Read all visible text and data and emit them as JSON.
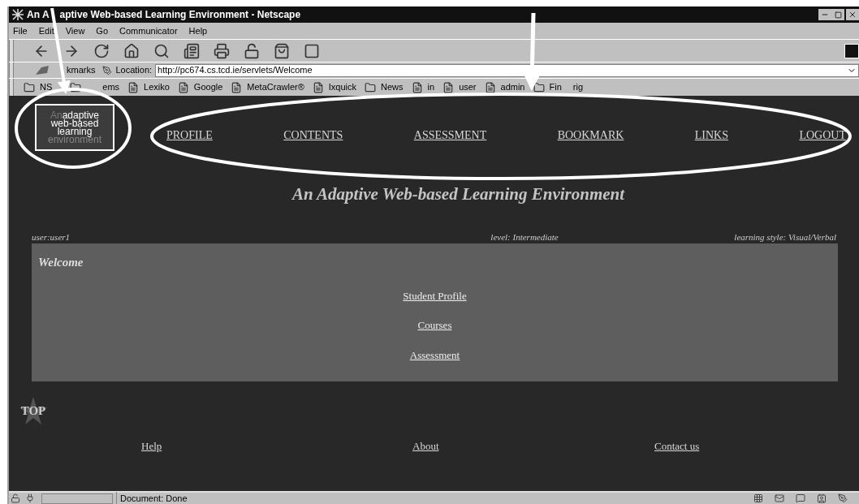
{
  "window": {
    "title_parts": [
      "An A",
      "aptive Web-based Learning Environment - Netscape"
    ]
  },
  "menu": [
    {
      "label": "File"
    },
    {
      "label": "Edit"
    },
    {
      "label": "View"
    },
    {
      "label": "Go"
    },
    {
      "label": "Communicator"
    },
    {
      "label": "Help"
    }
  ],
  "location_bar": {
    "bookmarks_label": "kmarks",
    "label": "Location:",
    "url": "http://pc674.cs.tcd.ie/servlets/Welcome"
  },
  "personal_toolbar": [
    {
      "kind": "folder",
      "parts": [
        "NS"
      ]
    },
    {
      "kind": "folder",
      "parts": [
        "ems"
      ]
    },
    {
      "kind": "page",
      "parts": [
        "Lexiko"
      ]
    },
    {
      "kind": "page",
      "parts": [
        "Google"
      ]
    },
    {
      "kind": "page",
      "parts": [
        "MetaCrawler®"
      ]
    },
    {
      "kind": "page",
      "parts": [
        "Ixquick"
      ]
    },
    {
      "kind": "folder",
      "parts": [
        "News"
      ]
    },
    {
      "kind": "page",
      "parts": [
        "in"
      ]
    },
    {
      "kind": "page",
      "parts": [
        "user"
      ]
    },
    {
      "kind": "page",
      "parts": [
        "admin"
      ]
    },
    {
      "kind": "folder",
      "parts": [
        "Fin",
        "rig"
      ]
    }
  ],
  "logo": {
    "lines": [
      {
        "text": "An",
        "dim": true
      },
      {
        "text": "adaptive",
        "dim": false
      },
      {
        "text": "web-based",
        "dim": false
      },
      {
        "text": "learning",
        "dim": false
      },
      {
        "text": "environment",
        "dim": true
      }
    ]
  },
  "nav": [
    "PROFILE",
    "CONTENTS",
    "ASSESSMENT",
    "BOOKMARK",
    "LINKS",
    "LOGOUT"
  ],
  "heading": "An Adaptive Web-based Learning Environment",
  "info": {
    "user": "user:user1",
    "level": "level: Intermediate",
    "style": "learning style: Visual/Verbal"
  },
  "panel": {
    "title": "Welcome",
    "links": [
      "Student Profile",
      "Courses",
      "Assessment"
    ]
  },
  "top_label": "TOP",
  "footer": [
    "Help",
    "About",
    "Contact us"
  ],
  "status_bar": {
    "text": "Document: Done",
    "level": 0
  }
}
